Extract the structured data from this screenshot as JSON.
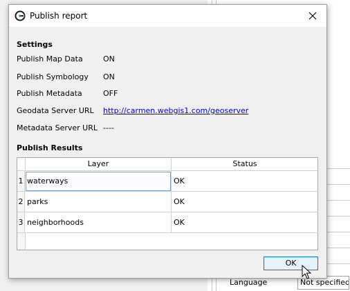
{
  "dialog": {
    "title": "Publish report",
    "close_icon": "close-icon",
    "app_icon": "app-logo-icon"
  },
  "settings": {
    "heading": "Settings",
    "rows": [
      {
        "label": "Publish Map Data",
        "value": "ON"
      },
      {
        "label": "Publish Symbology",
        "value": "ON"
      },
      {
        "label": "Publish Metadata",
        "value": "OFF"
      },
      {
        "label": "Geodata Server URL",
        "value": "http://carmen.webgis1.com/geoserver"
      },
      {
        "label": "Metadata Server URL",
        "value": "----"
      }
    ]
  },
  "results": {
    "heading": "Publish Results",
    "columns": [
      "Layer",
      "Status"
    ],
    "rows": [
      {
        "num": "1",
        "layer": "waterways",
        "status": "OK"
      },
      {
        "num": "2",
        "layer": "parks",
        "status": "OK"
      },
      {
        "num": "3",
        "layer": "neighborhoods",
        "status": "OK"
      }
    ]
  },
  "buttons": {
    "ok": "OK"
  },
  "background": {
    "language_label": "Language",
    "language_value": "Not specified"
  },
  "colors": {
    "link": "#0000ee",
    "button_border": "#0078d7",
    "button_bg": "#e5f1fb"
  }
}
